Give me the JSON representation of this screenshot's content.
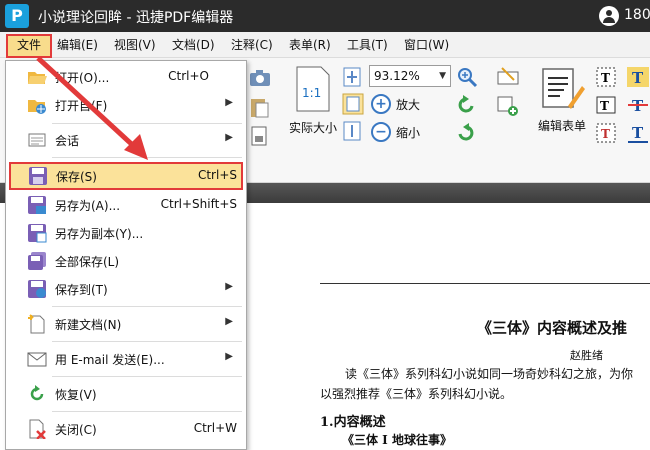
{
  "titlebar": {
    "app_title": "小说理论回眸 - 迅捷PDF编辑器",
    "user_text": "180"
  },
  "menubar": {
    "items": [
      "文件",
      "编辑(E)",
      "视图(V)",
      "文档(D)",
      "注释(C)",
      "表单(R)",
      "工具(T)",
      "窗口(W)"
    ]
  },
  "ribbon": {
    "zoom_value": "93.12%",
    "actual_size_label": "实际大小",
    "zoom_in_label": "放大",
    "zoom_out_label": "缩小",
    "edit_form_label": "编辑表单",
    "page_icon_text": "1:1"
  },
  "file_menu": {
    "items": [
      {
        "label": "打开(O)...",
        "shortcut": "Ctrl+O",
        "icon": "folder-open-icon"
      },
      {
        "label": "打开自(F)",
        "shortcut": "",
        "icon": "open-from-icon",
        "submenu": true
      },
      {
        "label": "会话",
        "shortcut": "",
        "icon": "session-icon",
        "submenu": true
      },
      {
        "label": "保存(S)",
        "shortcut": "Ctrl+S",
        "icon": "save-icon"
      },
      {
        "label": "另存为(A)...",
        "shortcut": "Ctrl+Shift+S",
        "icon": "save-as-icon"
      },
      {
        "label": "另存为副本(Y)...",
        "shortcut": "",
        "icon": "save-copy-icon"
      },
      {
        "label": "全部保存(L)",
        "shortcut": "",
        "icon": "save-all-icon"
      },
      {
        "label": "保存到(T)",
        "shortcut": "",
        "icon": "save-to-icon",
        "submenu": true
      },
      {
        "label": "新建文档(N)",
        "shortcut": "",
        "icon": "new-document-icon",
        "submenu": true
      },
      {
        "label": "用 E-mail 发送(E)...",
        "shortcut": "",
        "icon": "email-icon",
        "submenu": true
      },
      {
        "label": "恢复(V)",
        "shortcut": "",
        "icon": "restore-icon"
      },
      {
        "label": "关闭(C)",
        "shortcut": "Ctrl+W",
        "icon": "close-document-icon"
      }
    ]
  },
  "document": {
    "title": "《三体》内容概述及推",
    "author": "赵胜绪",
    "para1": "读《三体》系列科幻小说如同一场奇妙科幻之旅，为你",
    "para2": "以强烈推荐《三体》系列科幻小说。",
    "heading": "1.内容概述",
    "subheading": "《三体 I  地球往事》"
  },
  "colors": {
    "titlebar_bg": "#2b2b2b",
    "highlight_fill": "#fbe29a",
    "annotation_red": "#e23a3a",
    "accent_blue": "#1aa0dc"
  }
}
